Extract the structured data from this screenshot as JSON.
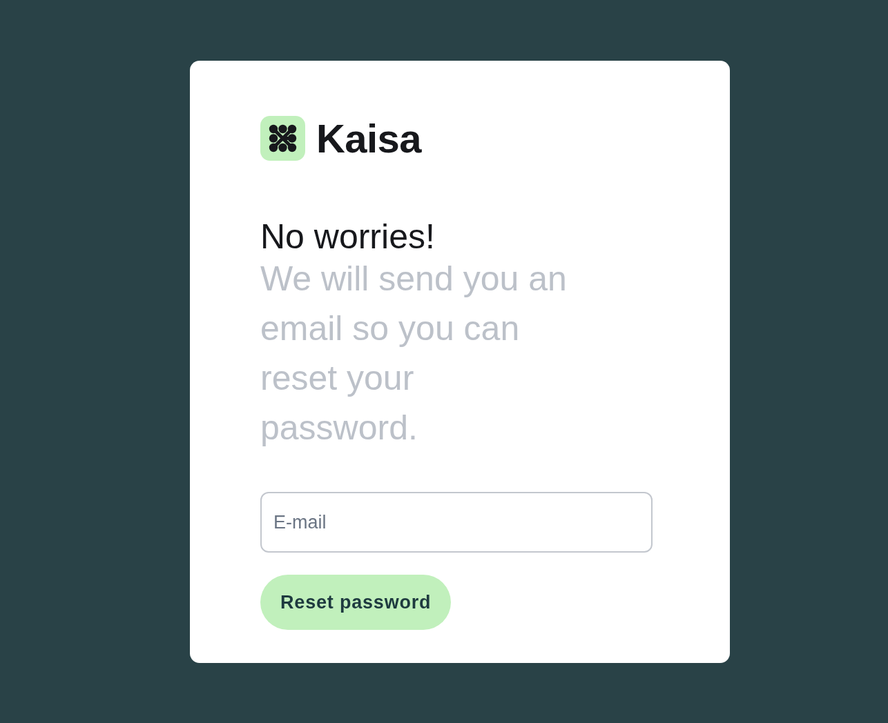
{
  "logo": {
    "name": "Kaisa"
  },
  "heading": "No worries!",
  "subtitle": "We will send you an email so you can reset your password.",
  "email_field": {
    "placeholder": "E-mail"
  },
  "submit_button": {
    "label": "Reset password"
  }
}
